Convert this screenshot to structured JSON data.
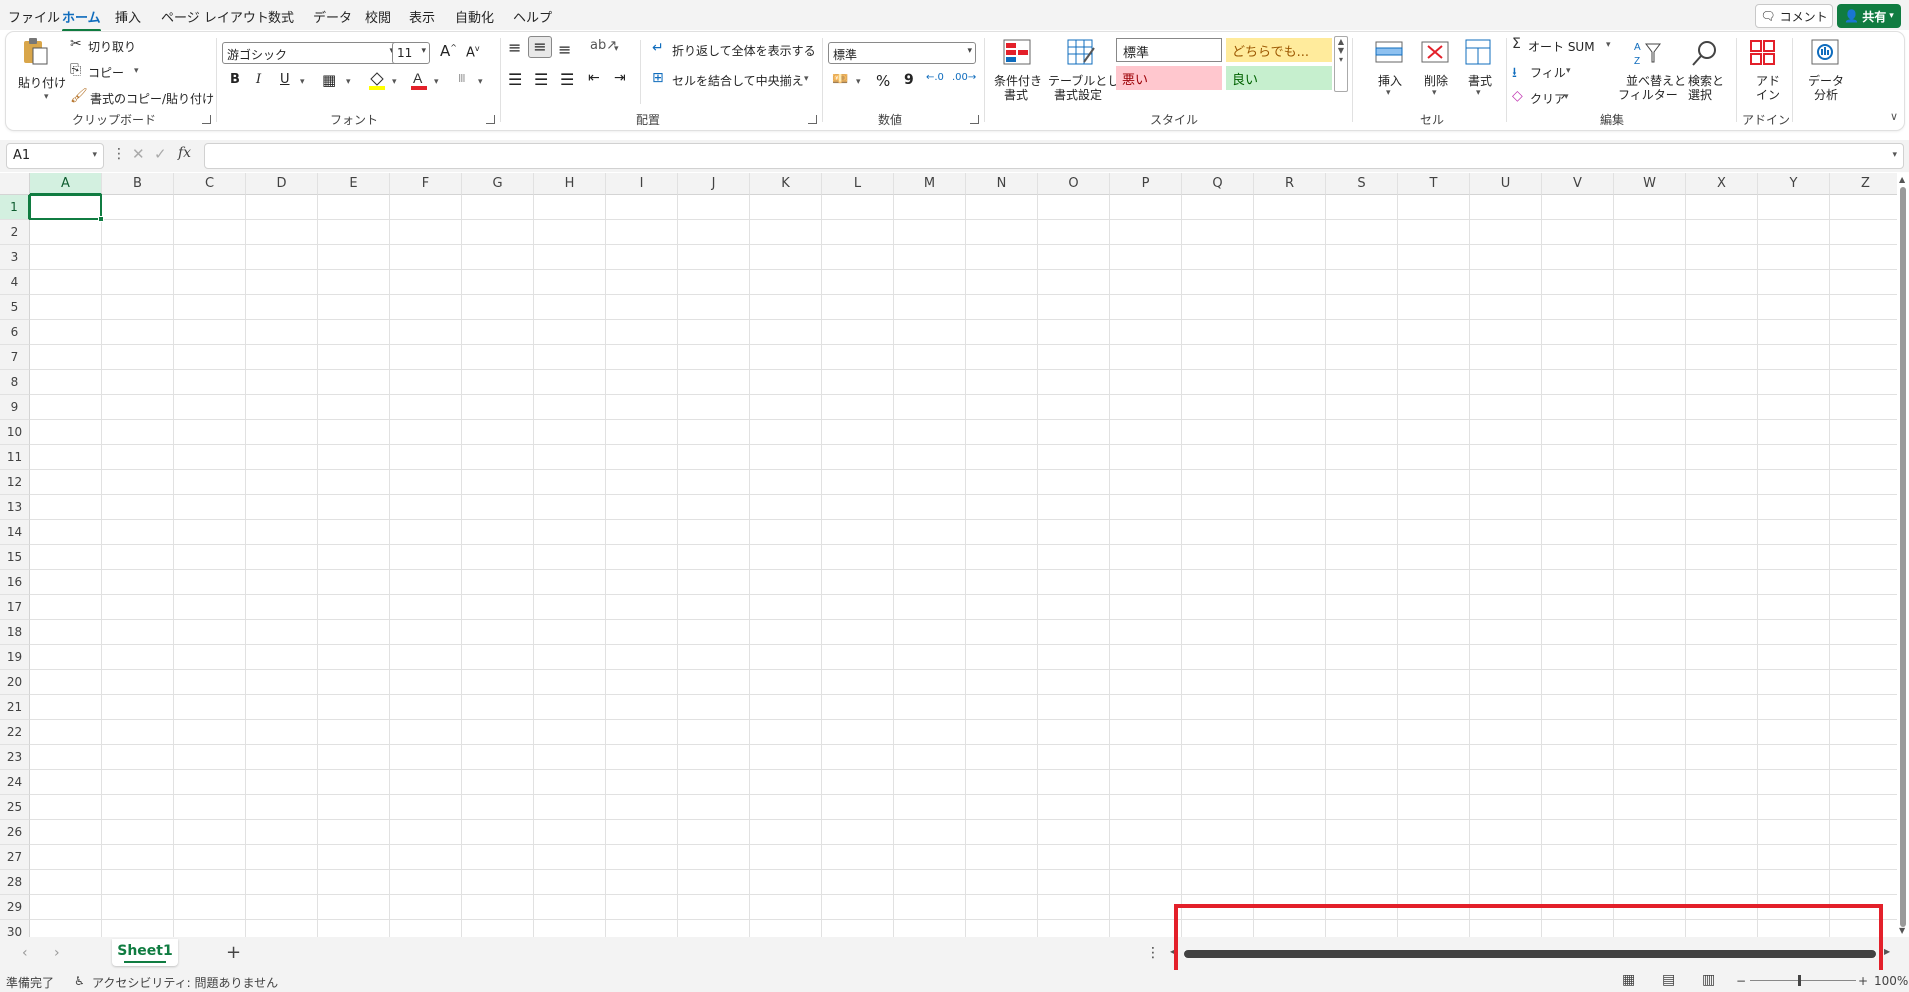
{
  "menu": {
    "tabs": [
      "ファイル",
      "ホーム",
      "挿入",
      "ページ レイアウト",
      "数式",
      "データ",
      "校閲",
      "表示",
      "自動化",
      "ヘルプ"
    ],
    "comment": "コメント",
    "share": "共有"
  },
  "ribbon": {
    "clipboard": {
      "paste": "貼り付け",
      "cut": "切り取り",
      "copy": "コピー",
      "format_painter": "書式のコピー/貼り付け",
      "label": "クリップボード"
    },
    "font": {
      "name": "游ゴシック",
      "size": "11",
      "label": "フォント",
      "bold": "B",
      "italic": "I",
      "underline": "U"
    },
    "alignment": {
      "wrap": "折り返して全体を表示する",
      "merge": "セルを結合して中央揃え",
      "label": "配置"
    },
    "number": {
      "format": "標準",
      "percent": "%",
      "comma": "9",
      "label": "数値"
    },
    "styles": {
      "conditional": [
        "条件付き",
        "書式"
      ],
      "table": [
        "テーブルとして",
        "書式設定"
      ],
      "normal": "標準",
      "neutral": "どちらでも...",
      "bad": "悪い",
      "good": "良い",
      "label": "スタイル"
    },
    "cells": {
      "insert": "挿入",
      "delete": "削除",
      "format": "書式",
      "label": "セル"
    },
    "editing": {
      "autosum": "オート SUM",
      "fill": "フィル",
      "clear": "クリア",
      "sort": [
        "並べ替えと",
        "フィルター"
      ],
      "find": [
        "検索と",
        "選択"
      ],
      "label": "編集"
    },
    "addins": {
      "addin": [
        "アド",
        "イン"
      ],
      "label": "アドイン"
    },
    "analysis": {
      "data_analysis": [
        "データ",
        "分析"
      ]
    }
  },
  "formula_bar": {
    "name_box": "A1",
    "fx": "fx",
    "value": ""
  },
  "grid": {
    "columns": [
      "A",
      "B",
      "C",
      "D",
      "E",
      "F",
      "G",
      "H",
      "I",
      "J",
      "K",
      "L",
      "M",
      "N",
      "O",
      "P",
      "Q",
      "R",
      "S",
      "T",
      "U",
      "V",
      "W",
      "X",
      "Y",
      "Z"
    ],
    "rows": [
      "1",
      "2",
      "3",
      "4",
      "5",
      "6",
      "7",
      "8",
      "9",
      "10",
      "11",
      "12",
      "13",
      "14",
      "15",
      "16",
      "17",
      "18",
      "19",
      "20",
      "21",
      "22",
      "23",
      "24",
      "25",
      "26",
      "27",
      "28",
      "29",
      "30"
    ],
    "active_cell": "A1"
  },
  "sheets": {
    "tabs": [
      "Sheet1"
    ],
    "add": "+"
  },
  "status": {
    "ready": "準備完了",
    "accessibility": "アクセシビリティ: 問題ありません",
    "zoom": "100%"
  },
  "colors": {
    "accent": "#107c41",
    "highlight": "#e3202a",
    "bad_bg": "#ffc7ce",
    "bad_fg": "#9c0006",
    "good_bg": "#c6efce",
    "good_fg": "#006100",
    "neutral_bg": "#ffeb9c",
    "neutral_fg": "#9c5700"
  }
}
